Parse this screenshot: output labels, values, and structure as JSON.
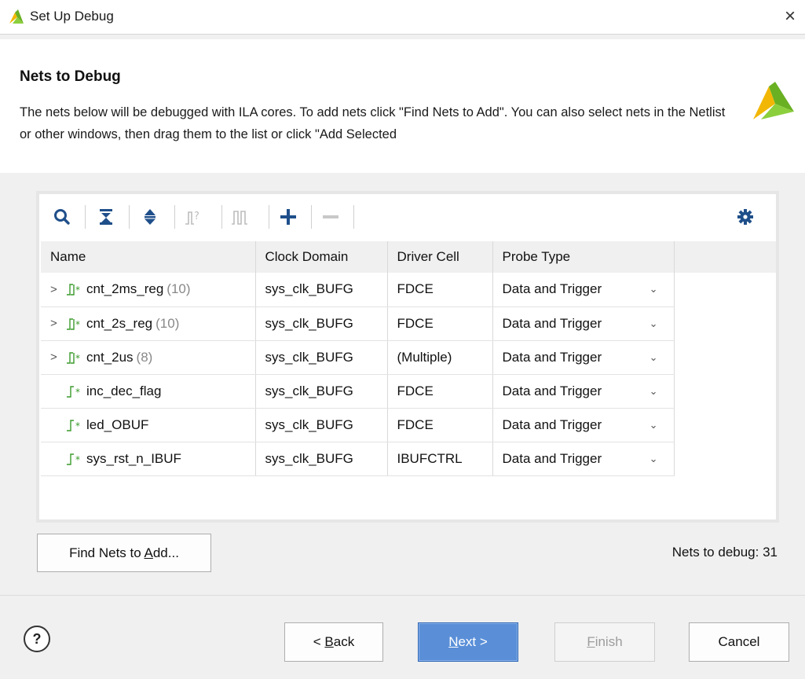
{
  "window": {
    "title": "Set Up Debug",
    "close_glyph": "×"
  },
  "header": {
    "heading": "Nets to Debug",
    "description": "The nets below will be debugged with ILA cores. To add nets click \"Find Nets to Add\". You can also select nets in the Netlist or other windows, then drag them to the list or click \"Add Selected"
  },
  "toolbar": {
    "icons": [
      "search-icon",
      "collapse-all-icon",
      "expand-all-icon",
      "clock-net-icon",
      "bus-net-icon",
      "add-icon",
      "remove-icon",
      "gear-icon"
    ]
  },
  "table": {
    "columns": [
      "Name",
      "Clock Domain",
      "Driver Cell",
      "Probe Type"
    ],
    "rows": [
      {
        "expandable": true,
        "name": "cnt_2ms_reg",
        "count": "(10)",
        "clock": "sys_clk_BUFG",
        "driver": "FDCE",
        "probe": "Data and Trigger"
      },
      {
        "expandable": true,
        "name": "cnt_2s_reg",
        "count": "(10)",
        "clock": "sys_clk_BUFG",
        "driver": "FDCE",
        "probe": "Data and Trigger"
      },
      {
        "expandable": true,
        "name": "cnt_2us",
        "count": "(8)",
        "clock": "sys_clk_BUFG",
        "driver": "(Multiple)",
        "probe": "Data and Trigger"
      },
      {
        "expandable": false,
        "name": "inc_dec_flag",
        "count": "",
        "clock": "sys_clk_BUFG",
        "driver": "FDCE",
        "probe": "Data and Trigger"
      },
      {
        "expandable": false,
        "name": "led_OBUF",
        "count": "",
        "clock": "sys_clk_BUFG",
        "driver": "FDCE",
        "probe": "Data and Trigger"
      },
      {
        "expandable": false,
        "name": "sys_rst_n_IBUF",
        "count": "",
        "clock": "sys_clk_BUFG",
        "driver": "IBUFCTRL",
        "probe": "Data and Trigger"
      }
    ]
  },
  "find_button": {
    "label_pre": "Find Nets to ",
    "label_accel": "A",
    "label_post": "dd..."
  },
  "nets_count": "Nets to debug: 31",
  "buttons": {
    "help": "?",
    "back": {
      "pre": "< ",
      "accel": "B",
      "post": "ack"
    },
    "next": {
      "pre": "",
      "accel": "N",
      "post": "ext >"
    },
    "finish": {
      "pre": "",
      "accel": "F",
      "post": "inish"
    },
    "cancel": "Cancel"
  },
  "colors": {
    "accent": "#5a8fd8",
    "net_icon": "#3a9a2a",
    "logo_yellow": "#f2b705",
    "logo_green": "#6ab023"
  }
}
